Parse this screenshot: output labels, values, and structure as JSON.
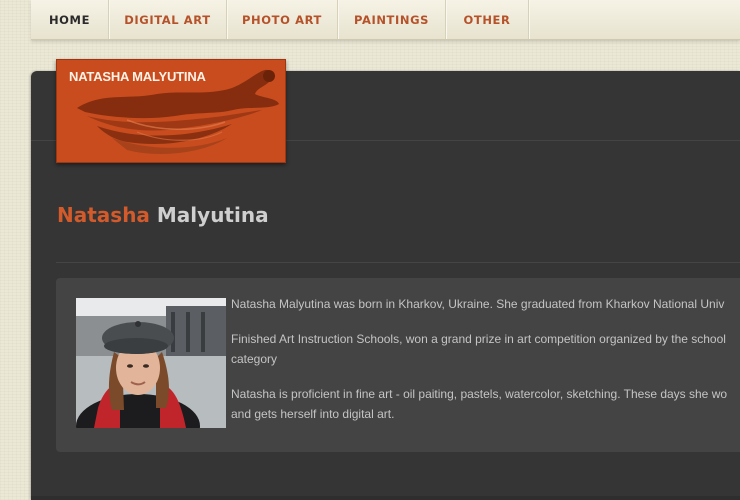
{
  "nav": {
    "items": [
      {
        "label": "HOME",
        "active": true
      },
      {
        "label": "DIGITAL ART",
        "active": false
      },
      {
        "label": "PHOTO ART",
        "active": false
      },
      {
        "label": "PAINTINGS",
        "active": false
      },
      {
        "label": "OTHER",
        "active": false
      }
    ]
  },
  "logo": {
    "text": "NATASHA MALYUTINA",
    "background_color": "#c84c1e"
  },
  "page": {
    "title_first": "Natasha",
    "title_last": "Malyutina",
    "accent_color": "#d25a2b"
  },
  "bio": {
    "paragraphs": [
      "Natasha Malyutina was born in Kharkov, Ukraine. She graduated from Kharkov National Univ",
      "Finished Art Instruction Schools, won a grand prize in art competition organized by the school\ncategory",
      "Natasha is proficient in fine art - oil paiting, pastels, watercolor, sketching. These days she wo\nand gets herself into digital art."
    ]
  }
}
